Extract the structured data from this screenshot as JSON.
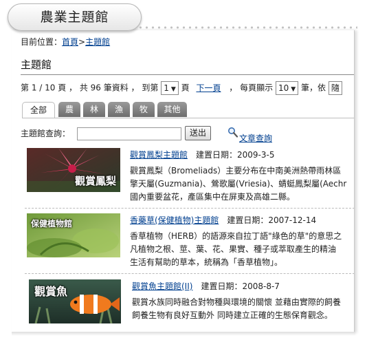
{
  "header": {
    "title": "農業主題館"
  },
  "breadcrumb": {
    "label": "目前位置：",
    "home": "首頁",
    "separator": ">",
    "current": "主題館"
  },
  "section_title": "主題館",
  "pager": {
    "page_text": "第 1 / 10 頁 ， 共 96 筆資料 ， 到第",
    "page_value": "1",
    "page_unit": "頁",
    "next": "下一頁",
    "per_page_text": "， 每頁顯示",
    "per_page_value": "10",
    "per_page_unit": "筆，依",
    "sort_value": "隨"
  },
  "tabs": [
    {
      "label": "全部",
      "active": true
    },
    {
      "label": "農"
    },
    {
      "label": "林"
    },
    {
      "label": "漁"
    },
    {
      "label": "牧"
    },
    {
      "label": "其他"
    }
  ],
  "search": {
    "label": "主題館查詢：",
    "button": "送出",
    "advanced": "文章查詢",
    "value": ""
  },
  "items": [
    {
      "title": "觀賞鳳梨主題館",
      "date_label": "建置日期：2009-3-5",
      "thumb_caption": "觀賞鳳梨",
      "desc": [
        "觀賞鳳梨（Bromeliads）主要分布在中南美洲熱帶雨林區",
        "擎天屬(Guzmania)、鶯歌屬(Vriesia)、蜻蜓鳳梨屬(Aechr",
        "國內重要盆花，產區集中在屏東及高雄二縣。"
      ]
    },
    {
      "title": "香藥草(保健植物)主題館",
      "date_label": "建置日期：2007-12-14",
      "thumb_caption": "保健植物館",
      "desc": [
        "香草植物（HERB）的語源來自拉丁語\"綠色的草\"的意思之",
        "凡植物之根、莖、葉、花、果實、種子或萃取產生的精油",
        "生活有幫助的草本，統稱為「香草植物」。"
      ]
    },
    {
      "title": "觀賞魚主題館(II)",
      "date_label": "建置日期：2008-8-7",
      "thumb_caption": "觀賞魚",
      "desc": [
        "觀賞水族同時融合對物種與環境的關懷 並藉由實際的飼養",
        "飼養生物有良好互動外 同時建立正確的生態保育觀念。"
      ]
    }
  ]
}
